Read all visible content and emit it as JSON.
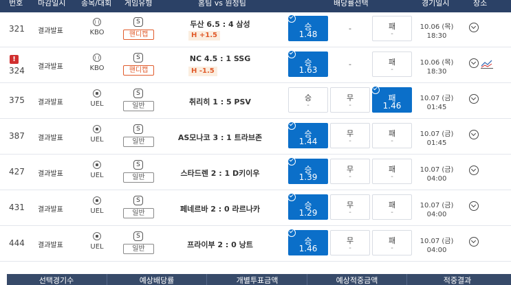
{
  "header": {
    "number": "번호",
    "deadline": "마감일시",
    "sport_league": "종목/대회",
    "game_type": "게임유형",
    "teams": "홈팀 vs 원정팀",
    "odds_select": "배당률선택",
    "game_datetime": "경기일시",
    "venue": "장소"
  },
  "rows": [
    {
      "number": "321",
      "status": "결과발표",
      "sport": "baseball",
      "league": "KBO",
      "type_letter": "S",
      "game_type": "핸디캡",
      "match": "두산 6.5 : 4 삼성",
      "handicap": "H +1.5",
      "win_label": "승",
      "win_odds": "1.48",
      "draw_label": "-",
      "draw_odds": "",
      "lose_label": "패",
      "lose_odds": "-",
      "date": "10.06 (목)",
      "time": "18:30"
    },
    {
      "number": "324",
      "alert": "!",
      "status": "결과발표",
      "sport": "baseball",
      "league": "KBO",
      "type_letter": "S",
      "game_type": "핸디캡",
      "match": "NC 4.5 : 1 SSG",
      "handicap": "H -1.5",
      "win_label": "승",
      "win_odds": "1.63",
      "draw_label": "-",
      "draw_odds": "",
      "lose_label": "패",
      "lose_odds": "-",
      "date": "10.06 (목)",
      "time": "18:30"
    },
    {
      "number": "375",
      "status": "결과발표",
      "sport": "soccer",
      "league": "UEL",
      "type_letter": "S",
      "game_type": "일반",
      "match": "취리히 1 : 5 PSV",
      "win_label": "승",
      "win_odds": "-",
      "draw_label": "무",
      "draw_odds": "-",
      "lose_label": "패",
      "lose_odds": "1.46",
      "date": "10.07 (금)",
      "time": "01:45"
    },
    {
      "number": "387",
      "status": "결과발표",
      "sport": "soccer",
      "league": "UEL",
      "type_letter": "S",
      "game_type": "일반",
      "match": "AS모나코 3 : 1 트라브존",
      "win_label": "승",
      "win_odds": "1.44",
      "draw_label": "무",
      "draw_odds": "-",
      "lose_label": "패",
      "lose_odds": "-",
      "date": "10.07 (금)",
      "time": "01:45"
    },
    {
      "number": "427",
      "status": "결과발표",
      "sport": "soccer",
      "league": "UEL",
      "type_letter": "S",
      "game_type": "일반",
      "match": "스타드렌 2 : 1 D키이우",
      "win_label": "승",
      "win_odds": "1.39",
      "draw_label": "무",
      "draw_odds": "-",
      "lose_label": "패",
      "lose_odds": "-",
      "date": "10.07 (금)",
      "time": "04:00"
    },
    {
      "number": "431",
      "status": "결과발표",
      "sport": "soccer",
      "league": "UEL",
      "type_letter": "S",
      "game_type": "일반",
      "match": "페네르바 2 : 0 라르나카",
      "win_label": "승",
      "win_odds": "1.29",
      "draw_label": "무",
      "draw_odds": "-",
      "lose_label": "패",
      "lose_odds": "-",
      "date": "10.07 (금)",
      "time": "04:00"
    },
    {
      "number": "444",
      "status": "결과발표",
      "sport": "soccer",
      "league": "UEL",
      "type_letter": "S",
      "game_type": "일반",
      "match": "프라이부 2 : 0 낭트",
      "win_label": "승",
      "win_odds": "1.46",
      "draw_label": "무",
      "draw_odds": "-",
      "lose_label": "패",
      "lose_odds": "-",
      "date": "10.07 (금)",
      "time": "04:00"
    }
  ],
  "footer": {
    "selected_count": "선택경기수",
    "expected_odds": "예상배당률",
    "vote_amount": "개별투표금액",
    "expected_payout": "예상적중금액",
    "result": "적중결과"
  },
  "colors": {
    "header_bg": "#2b4166",
    "selected_odds": "#0b6fc9",
    "handicap_accent": "#e05a2a",
    "alert": "#d12f2f"
  }
}
